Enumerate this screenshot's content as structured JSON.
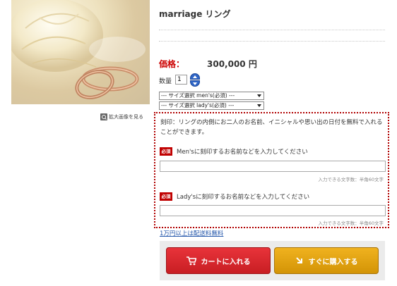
{
  "product": {
    "title": "marriage リング",
    "price_label": "価格：",
    "price_value": "300,000 円",
    "zoom_label": "拡大画像を見る"
  },
  "quantity": {
    "label": "数量",
    "value": "1"
  },
  "size_selects": [
    {
      "value": "--- サイズ選択 men's(必須) ---"
    },
    {
      "value": "--- サイズ選択 lady's(必須) ---"
    }
  ],
  "engraving": {
    "description": "刻印：リングの内側にお二人のお名前、イニシャルや思い出の日付を無料で入れることができます。",
    "required_badge": "必須",
    "mens_label": "Men'sに刻印するお名前などを入力してください",
    "ladys_label": "Lady'sに刻印するお名前などを入力してください",
    "char_note": "入力できる文字数：半角60文字",
    "mens_value": "",
    "ladys_value": ""
  },
  "shipping_note": "1万円以上は配送料無料",
  "buttons": {
    "add_to_cart": "カートに入れる",
    "buy_now": "すぐに購入する"
  },
  "colors": {
    "price_label": "#cc0000",
    "required_badge": "#c00000",
    "engrave_border": "#b00000",
    "cart_button": "#d2252b",
    "buy_button": "#e6a614",
    "link": "#2255aa"
  }
}
